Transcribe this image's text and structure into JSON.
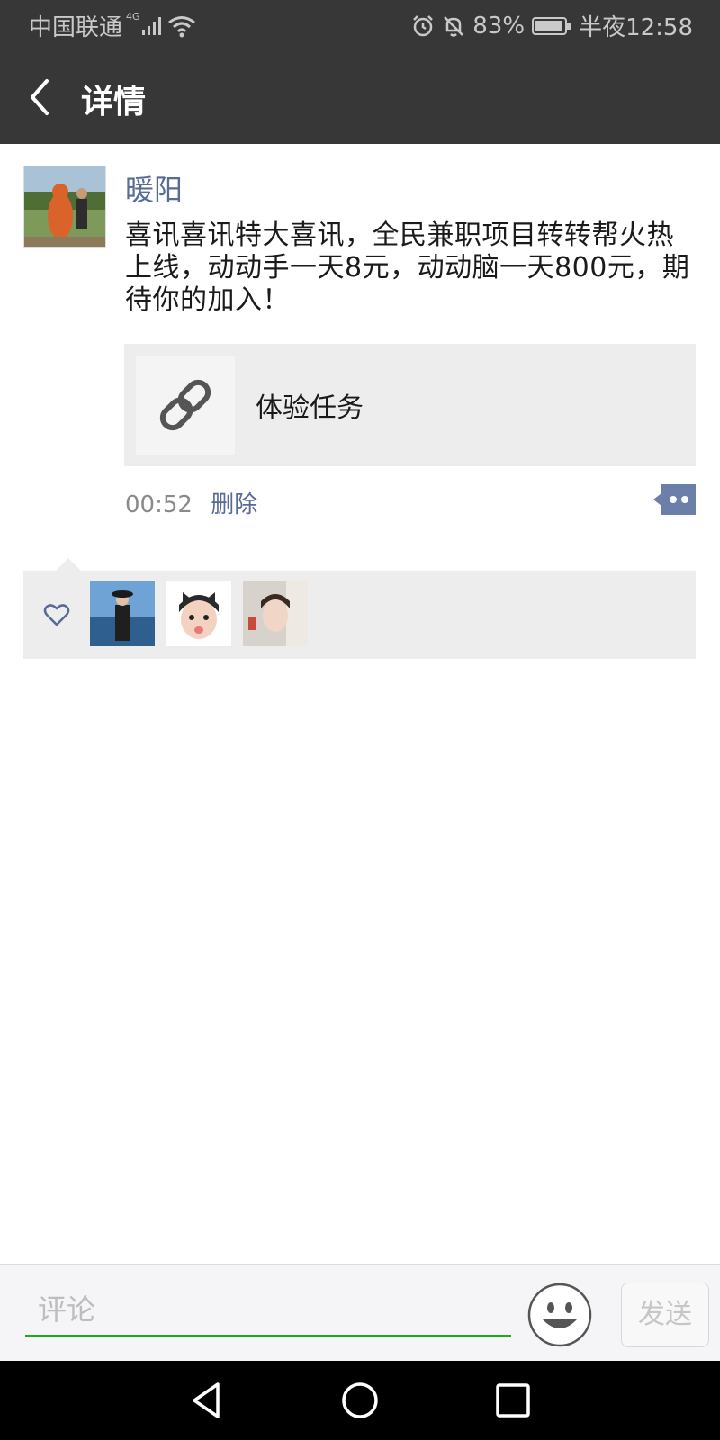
{
  "status_bar": {
    "carrier": "中国联通",
    "network": "4G",
    "battery": "83%",
    "time": "半夜12:58"
  },
  "header": {
    "title": "详情"
  },
  "post": {
    "author": "暖阳",
    "text": "喜讯喜讯特大喜讯，全民兼职项目转转帮火热上线，动动手一天8元，动动脑一天800元，期待你的加入！",
    "link_title": "体验任务",
    "time": "00:52",
    "delete_label": "删除"
  },
  "likes": {
    "count_shown": 3
  },
  "comment_bar": {
    "placeholder": "评论",
    "send_label": "发送"
  },
  "colors": {
    "bar_bg": "#373737",
    "link_blue": "#576b95",
    "input_green": "#1aad19",
    "panel_bg": "#ededed"
  }
}
